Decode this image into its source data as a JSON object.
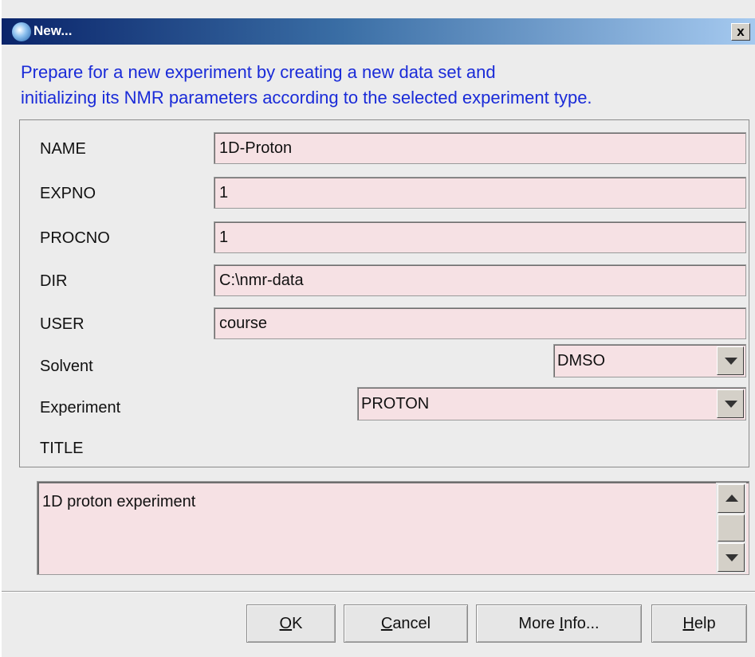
{
  "window": {
    "title": "New...",
    "close_label": "x"
  },
  "description": {
    "line1": "Prepare for a new experiment by creating a new data set and",
    "line2": "initializing its NMR parameters according to the selected experiment type."
  },
  "fields": {
    "name": {
      "label": "NAME",
      "value": "1D-Proton"
    },
    "expno": {
      "label": "EXPNO",
      "value": "1"
    },
    "procno": {
      "label": "PROCNO",
      "value": "1"
    },
    "dir": {
      "label": "DIR",
      "value": "C:\\nmr-data"
    },
    "user": {
      "label": "USER",
      "value": "course"
    },
    "solvent": {
      "label": "Solvent",
      "value": "DMSO"
    },
    "experiment": {
      "label": "Experiment",
      "value": "PROTON"
    },
    "title": {
      "label": "TITLE",
      "value": "1D proton experiment"
    }
  },
  "buttons": {
    "ok": {
      "mnemonic": "O",
      "rest": "K"
    },
    "cancel": {
      "mnemonic": "C",
      "rest": "ancel"
    },
    "more_info": {
      "pre": "More ",
      "mnemonic": "I",
      "rest": "nfo..."
    },
    "help": {
      "mnemonic": "H",
      "rest": "elp"
    }
  },
  "colors": {
    "field_bg": "#f6e1e4",
    "desc_text": "#1a2bd8",
    "titlebar_start": "#0a246a",
    "titlebar_end": "#a6caf0"
  }
}
